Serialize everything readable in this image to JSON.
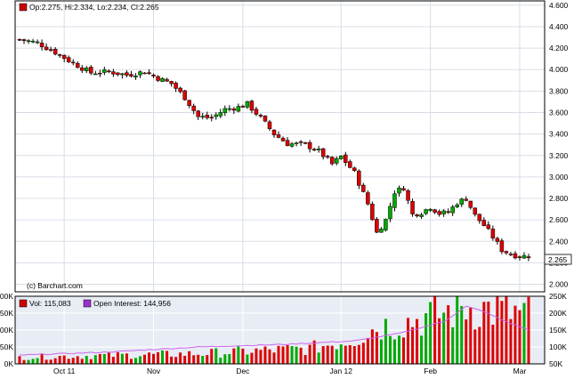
{
  "header": {
    "ohlc_label": "Op:2.275, Hi:2.334, Lo:2.234, Cl:2.265",
    "ohlc_color": "#cc0000",
    "last_price": "2.265",
    "credit": "(c) Barchart.com"
  },
  "volume_legend": {
    "volume_label": "Vol: 115,083",
    "volume_color": "#cc0000",
    "oi_label": "Open Interest: 144,956",
    "oi_color": "#9933cc"
  },
  "colors": {
    "up": "#00aa00",
    "down": "#dd0000",
    "grid": "#d8dde6",
    "frame": "#000000",
    "volume_bg": "#e8ecf4",
    "oi_line": "#cc66ee"
  },
  "chart_data": [
    {
      "type": "candlestick",
      "title": "",
      "x": {
        "ticks": [
          "Oct 11",
          "Nov",
          "Dec",
          "Jan 12",
          "Feb",
          "Mar"
        ],
        "bar_count": 115
      },
      "y_ticks": [
        "4.600",
        "4.400",
        "4.200",
        "4.000",
        "3.800",
        "3.600",
        "3.400",
        "3.200",
        "3.000",
        "2.800",
        "2.600",
        "2.400",
        "2.200",
        "2.000"
      ],
      "ylim": [
        1.93,
        4.64
      ],
      "y_scale": "linear",
      "grid": true,
      "anchors": [
        [
          0,
          4.28
        ],
        [
          4,
          4.25
        ],
        [
          8,
          4.16
        ],
        [
          12,
          4.06
        ],
        [
          16,
          3.97
        ],
        [
          20,
          3.98
        ],
        [
          24,
          3.95
        ],
        [
          28,
          3.98
        ],
        [
          31,
          3.92
        ],
        [
          34,
          3.87
        ],
        [
          37,
          3.74
        ],
        [
          40,
          3.56
        ],
        [
          43,
          3.55
        ],
        [
          46,
          3.63
        ],
        [
          49,
          3.65
        ],
        [
          51,
          3.68
        ],
        [
          54,
          3.55
        ],
        [
          57,
          3.4
        ],
        [
          60,
          3.31
        ],
        [
          64,
          3.3
        ],
        [
          67,
          3.24
        ],
        [
          70,
          3.12
        ],
        [
          72,
          3.19
        ],
        [
          75,
          3.04
        ],
        [
          78,
          2.75
        ],
        [
          80,
          2.48
        ],
        [
          82,
          2.6
        ],
        [
          84,
          2.86
        ],
        [
          86,
          2.9
        ],
        [
          88,
          2.65
        ],
        [
          90,
          2.67
        ],
        [
          92,
          2.72
        ],
        [
          94,
          2.66
        ],
        [
          96,
          2.67
        ],
        [
          98,
          2.76
        ],
        [
          100,
          2.8
        ],
        [
          102,
          2.64
        ],
        [
          104,
          2.55
        ],
        [
          106,
          2.44
        ],
        [
          108,
          2.32
        ],
        [
          110,
          2.28
        ],
        [
          112,
          2.26
        ],
        [
          114,
          2.265
        ]
      ]
    },
    {
      "type": "bar",
      "title": "",
      "series": [
        {
          "name": "Vol",
          "y_ticks": [
            "200K",
            "150K",
            "100K",
            "50K",
            "0K"
          ],
          "ylim": [
            0,
            200000
          ]
        },
        {
          "name": "Open Interest",
          "y_ticks": [
            "250K",
            "200K",
            "150K",
            "100K",
            "50K"
          ],
          "ylim": [
            50000,
            250000
          ]
        }
      ],
      "oi_anchors": [
        [
          0,
          76000
        ],
        [
          20,
          85000
        ],
        [
          40,
          100000
        ],
        [
          60,
          108000
        ],
        [
          75,
          118000
        ],
        [
          85,
          140000
        ],
        [
          95,
          175000
        ],
        [
          100,
          220000
        ],
        [
          104,
          205000
        ],
        [
          108,
          180000
        ],
        [
          114,
          150000
        ]
      ],
      "vol_anchors": [
        [
          0,
          20000
        ],
        [
          20,
          25000
        ],
        [
          40,
          30000
        ],
        [
          55,
          40000
        ],
        [
          65,
          45000
        ],
        [
          75,
          75000
        ],
        [
          80,
          110000
        ],
        [
          85,
          120000
        ],
        [
          92,
          140000
        ],
        [
          100,
          170000
        ],
        [
          106,
          160000
        ],
        [
          114,
          145000
        ]
      ]
    }
  ]
}
